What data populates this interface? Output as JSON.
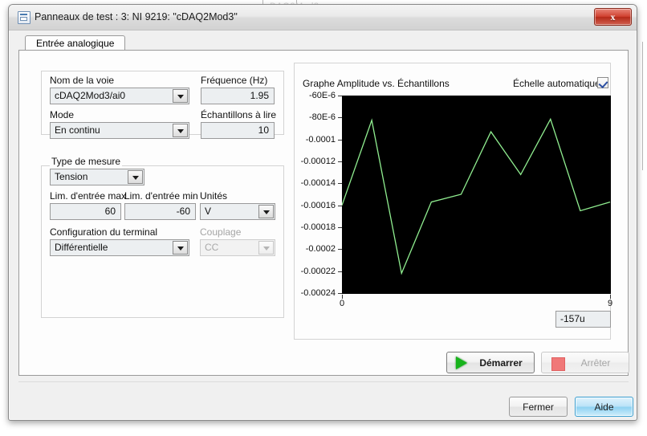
{
  "window": {
    "title": "Panneaux de test : 3:  NI 9219: \"cDAQ2Mod3\"",
    "close_label": "x",
    "ghost_text": "cDAQ2Mod3"
  },
  "tabs": [
    {
      "label": "Entrée analogique",
      "active": true
    }
  ],
  "channel_group": {
    "channel_name_label": "Nom de la voie",
    "channel_name_value": "cDAQ2Mod3/ai0",
    "mode_label": "Mode",
    "mode_value": "En continu",
    "frequency_label": "Fréquence (Hz)",
    "frequency_value": "1.95",
    "samples_label": "Échantillons à lire",
    "samples_value": "10"
  },
  "measurement_group": {
    "measurement_type_label": "Type de mesure",
    "measurement_type_value": "Tension",
    "max_input_label": "Lim. d'entrée max",
    "max_input_value": "60",
    "min_input_label": "Lim. d'entrée min",
    "min_input_value": "-60",
    "units_label": "Unités",
    "units_value": "V",
    "terminal_config_label": "Configuration du terminal",
    "terminal_config_value": "Différentielle",
    "coupling_label": "Couplage",
    "coupling_value": "CC",
    "coupling_disabled": true
  },
  "graph_panel": {
    "title": "Graphe Amplitude vs. Échantillons",
    "autoscale_label": "Échelle automatique",
    "autoscale_checked": true,
    "readout_value": "-157u"
  },
  "actions": {
    "start_label": "Démarrer",
    "stop_label": "Arrêter",
    "stop_disabled": true,
    "close_label": "Fermer",
    "help_label": "Aide"
  },
  "colors": {
    "plot_background": "#000000",
    "trace": "#90ee90",
    "close_button": "#c0392b",
    "help_button": "#8fd2f2",
    "start_icon": "#17b31b",
    "stop_icon": "#f07878"
  },
  "chart_data": {
    "type": "line",
    "title": "Graphe Amplitude vs. Échantillons",
    "xlabel": "",
    "ylabel": "",
    "x": [
      0,
      1,
      2,
      3,
      4,
      5,
      6,
      7,
      8,
      9
    ],
    "values": [
      -0.00016,
      -8.25e-05,
      -0.000222,
      -0.000157,
      -0.00015,
      -9.3e-05,
      -0.000132,
      -8.15e-05,
      -0.000165,
      -0.000157
    ],
    "series": [
      {
        "name": "cDAQ2Mod3/ai0",
        "values": [
          -0.00016,
          -8.25e-05,
          -0.000222,
          -0.000157,
          -0.00015,
          -9.3e-05,
          -0.000132,
          -8.15e-05,
          -0.000165,
          -0.000157
        ]
      }
    ],
    "xlim": [
      0,
      9
    ],
    "ylim": [
      -0.00024,
      -6e-05
    ],
    "xticks": [
      "0",
      "9"
    ],
    "xtick_values": [
      0,
      9
    ],
    "yticks": [
      "-60E-6",
      "-80E-6",
      "-0.0001",
      "-0.00012",
      "-0.00014",
      "-0.00016",
      "-0.00018",
      "-0.0002",
      "-0.00022",
      "-0.00024"
    ],
    "ytick_values": [
      -6e-05,
      -8e-05,
      -0.0001,
      -0.00012,
      -0.00014,
      -0.00016,
      -0.00018,
      -0.0002,
      -0.00022,
      -0.00024
    ],
    "grid": false,
    "legend": false,
    "line_color": "#90ee90",
    "background": "#000000"
  }
}
